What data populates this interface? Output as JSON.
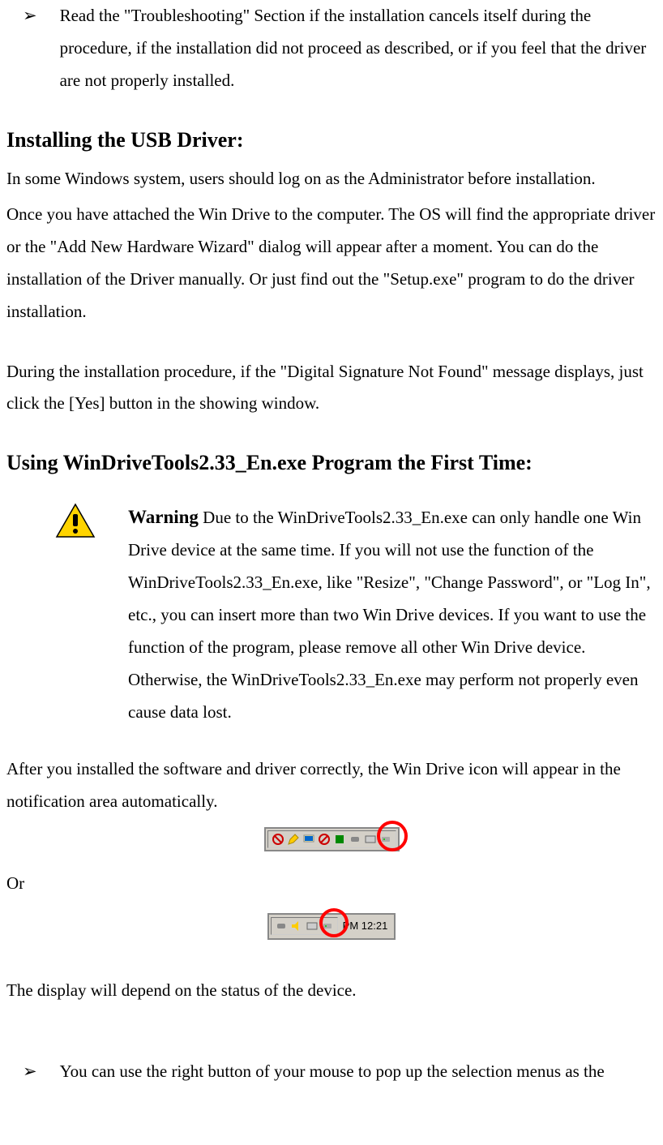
{
  "bullet1": "Read the \"Troubleshooting\" Section if the installation cancels itself during the procedure, if the installation did not proceed as described, or if you feel that the driver are not properly installed.",
  "heading1": "Installing the USB Driver:",
  "para1": "In some Windows system, users should log on as the Administrator before installation.",
  "para2": "Once you have attached the Win Drive to the computer. The OS will find the appropriate driver or the \"Add New Hardware Wizard\" dialog will appear after a moment. You can do the installation of the Driver manually. Or just find out the \"Setup.exe\" program to do the driver installation.",
  "para3": "During the installation procedure, if the \"Digital Signature Not Found\" message displays, just click the [Yes] button in the showing window.",
  "heading2": "Using WinDriveTools2.33_En.exe Program the First Time:",
  "warning_label": "Warning",
  "warning_text": "Due to the WinDriveTools2.33_En.exe can only handle one Win Drive device at the same time. If you will not use the function of the WinDriveTools2.33_En.exe, like \"Resize\", \"Change Password\", or \"Log In\", etc., you can insert more than two Win Drive devices. If you want to use the function of the program, please remove all other Win Drive device. Otherwise, the WinDriveTools2.33_En.exe may perform not properly even cause data lost.",
  "para4": "After you installed the software and driver correctly, the Win Drive icon will appear in the notification area automatically.",
  "or_text": "Or",
  "clock_text": "PM 12:21",
  "para5": "The display will depend on the status of the device.",
  "bullet2": "You can use the right button of your mouse to pop up the selection menus as the"
}
